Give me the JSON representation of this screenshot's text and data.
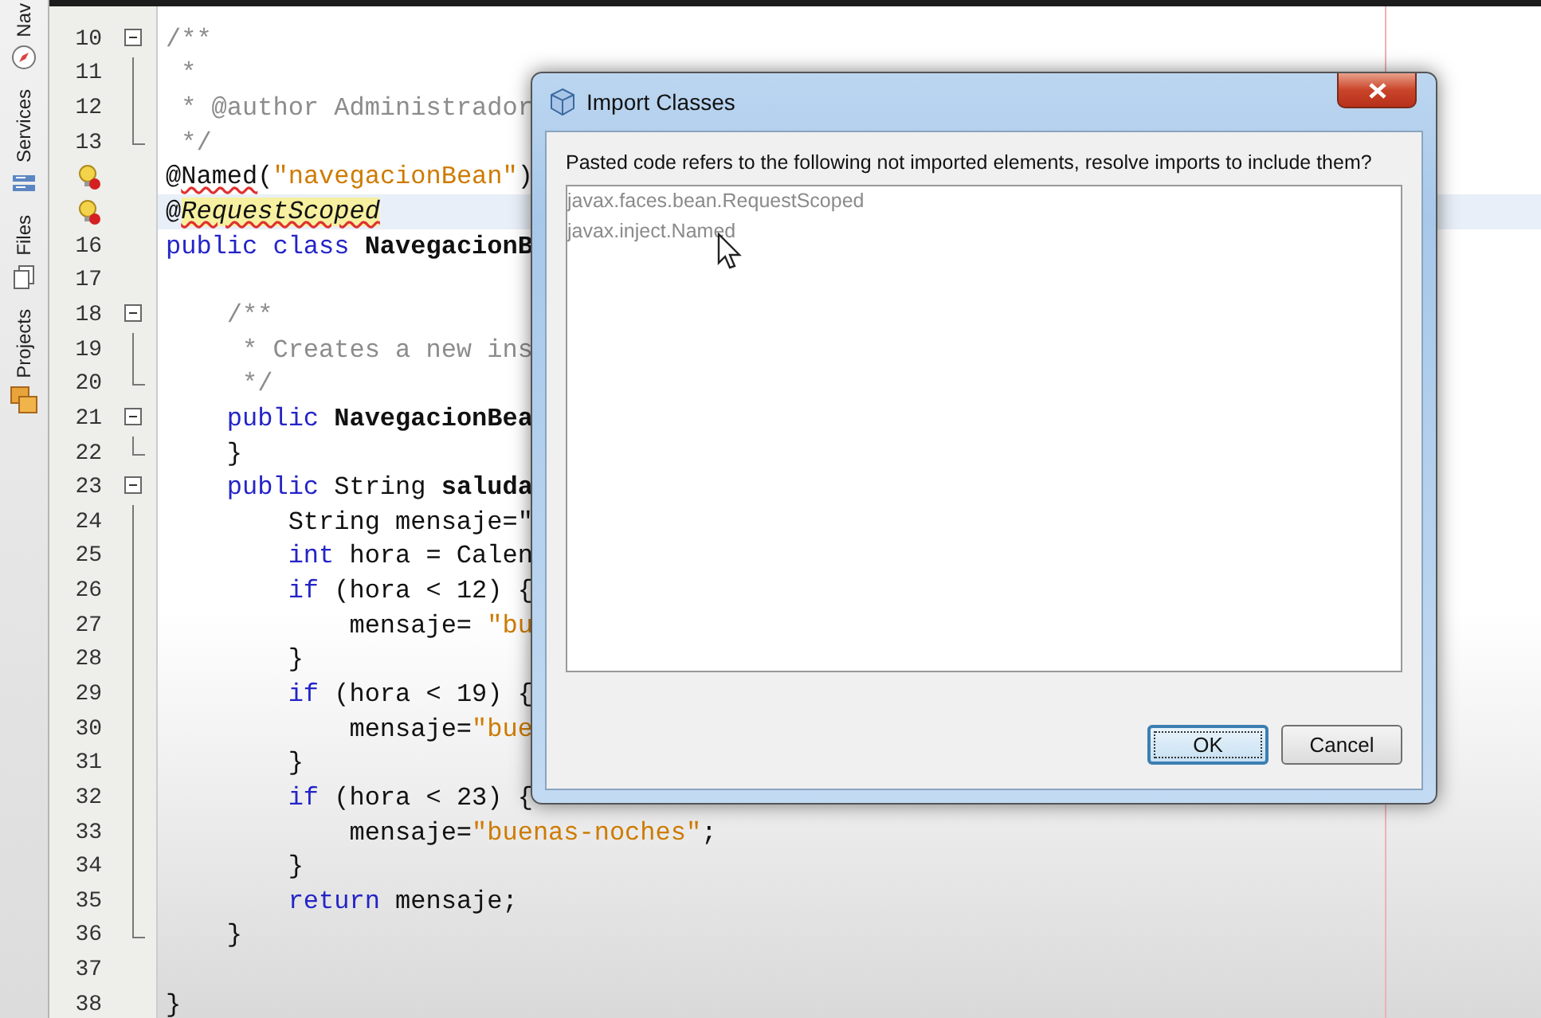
{
  "side_tabs": [
    {
      "label": "Nav"
    },
    {
      "label": "Services"
    },
    {
      "label": "Files"
    },
    {
      "label": "Projects"
    }
  ],
  "editor": {
    "lines": [
      {
        "number": "10",
        "kind": "open",
        "segments": [
          {
            "text": "/**",
            "kind": "comment"
          }
        ]
      },
      {
        "number": "11",
        "kind": "inside",
        "segments": [
          {
            "text": " *",
            "kind": "comment"
          }
        ]
      },
      {
        "number": "12",
        "kind": "inside",
        "segments": [
          {
            "text": " * @author Administrador",
            "kind": "comment"
          }
        ]
      },
      {
        "number": "13",
        "kind": "end",
        "segments": [
          {
            "text": " */",
            "kind": "comment"
          }
        ]
      },
      {
        "kind": "hint",
        "segments": [
          {
            "text": "@",
            "kind": "plain"
          },
          {
            "text": "Named",
            "kind": "error"
          },
          {
            "text": "(",
            "kind": "plain"
          },
          {
            "text": "\"navegacionBean\"",
            "kind": "string"
          },
          {
            "text": ")",
            "kind": "plain"
          }
        ]
      },
      {
        "kind": "hint",
        "current": true,
        "segments": [
          {
            "text": "@",
            "kind": "plain"
          },
          {
            "text": "RequestScoped",
            "kind": "error-highlight"
          }
        ]
      },
      {
        "number": "16",
        "kind": "plain",
        "segments": [
          {
            "text": "public class ",
            "kind": "keyword"
          },
          {
            "text": "NavegacionB",
            "kind": "bold"
          }
        ]
      },
      {
        "number": "17",
        "kind": "plain"
      },
      {
        "number": "18",
        "kind": "open",
        "segments": [
          {
            "text": "    /**",
            "kind": "comment"
          }
        ]
      },
      {
        "number": "19",
        "kind": "inside",
        "segments": [
          {
            "text": "     * Creates a new ins",
            "kind": "comment"
          }
        ]
      },
      {
        "number": "20",
        "kind": "end",
        "segments": [
          {
            "text": "     */",
            "kind": "comment"
          }
        ]
      },
      {
        "number": "21",
        "kind": "open",
        "segments": [
          {
            "text": "    public ",
            "kind": "keyword"
          },
          {
            "text": "NavegacionBea",
            "kind": "bold"
          }
        ]
      },
      {
        "number": "22",
        "kind": "end",
        "segments": [
          {
            "text": "    }",
            "kind": "plain"
          }
        ]
      },
      {
        "number": "23",
        "kind": "open",
        "segments": [
          {
            "text": "    public ",
            "kind": "keyword"
          },
          {
            "text": "String ",
            "kind": "plain"
          },
          {
            "text": "saluda",
            "kind": "bold"
          }
        ]
      },
      {
        "number": "24",
        "kind": "inside",
        "segments": [
          {
            "text": "        String mensaje=\"",
            "kind": "plain"
          }
        ]
      },
      {
        "number": "25",
        "kind": "inside",
        "segments": [
          {
            "text": "        int ",
            "kind": "keyword"
          },
          {
            "text": "hora = Calen",
            "kind": "plain"
          }
        ]
      },
      {
        "number": "26",
        "kind": "inside",
        "segments": [
          {
            "text": "        if ",
            "kind": "keyword"
          },
          {
            "text": "(hora < 12) {",
            "kind": "plain"
          }
        ]
      },
      {
        "number": "27",
        "kind": "inside",
        "segments": [
          {
            "text": "            mensaje= ",
            "kind": "plain"
          },
          {
            "text": "\"bu",
            "kind": "string"
          }
        ]
      },
      {
        "number": "28",
        "kind": "inside",
        "segments": [
          {
            "text": "        }",
            "kind": "plain"
          }
        ]
      },
      {
        "number": "29",
        "kind": "inside",
        "segments": [
          {
            "text": "        if ",
            "kind": "keyword"
          },
          {
            "text": "(hora < 19) {",
            "kind": "plain"
          }
        ]
      },
      {
        "number": "30",
        "kind": "inside",
        "segments": [
          {
            "text": "            mensaje=",
            "kind": "plain"
          },
          {
            "text": "\"bue",
            "kind": "string"
          }
        ]
      },
      {
        "number": "31",
        "kind": "inside",
        "segments": [
          {
            "text": "        }",
            "kind": "plain"
          }
        ]
      },
      {
        "number": "32",
        "kind": "inside",
        "segments": [
          {
            "text": "        if ",
            "kind": "keyword"
          },
          {
            "text": "(hora < 23) {",
            "kind": "plain"
          }
        ]
      },
      {
        "number": "33",
        "kind": "inside",
        "segments": [
          {
            "text": "            mensaje=",
            "kind": "plain"
          },
          {
            "text": "\"buenas-noches\"",
            "kind": "string"
          },
          {
            "text": ";",
            "kind": "plain"
          }
        ]
      },
      {
        "number": "34",
        "kind": "inside",
        "segments": [
          {
            "text": "        }",
            "kind": "plain"
          }
        ]
      },
      {
        "number": "35",
        "kind": "inside",
        "segments": [
          {
            "text": "        return ",
            "kind": "keyword"
          },
          {
            "text": "mensaje;",
            "kind": "plain"
          }
        ]
      },
      {
        "number": "36",
        "kind": "end",
        "segments": [
          {
            "text": "    }",
            "kind": "plain"
          }
        ]
      },
      {
        "number": "37",
        "kind": "plain"
      },
      {
        "number": "38",
        "kind": "plain",
        "segments": [
          {
            "text": "}",
            "kind": "plain"
          }
        ]
      }
    ]
  },
  "dialog": {
    "title": "Import Classes",
    "message": "Pasted code refers to the following not imported elements, resolve imports to include them?",
    "items": [
      {
        "label": "javax.faces.bean.RequestScoped"
      },
      {
        "label": "javax.inject.Named"
      }
    ],
    "buttons": [
      {
        "label": "OK",
        "default": true
      },
      {
        "label": "Cancel",
        "default": false
      }
    ]
  }
}
